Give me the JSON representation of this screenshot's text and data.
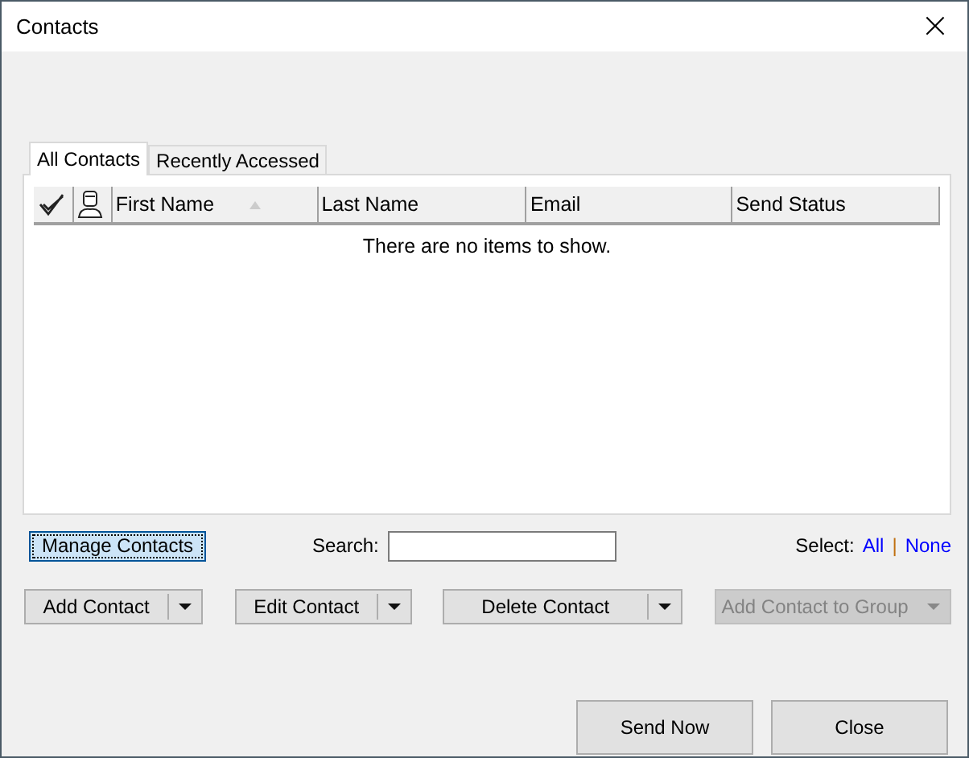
{
  "window": {
    "title": "Contacts",
    "close": "×"
  },
  "tabs": [
    {
      "label": "All Contacts",
      "selected": true
    },
    {
      "label": "Recently Accessed",
      "selected": false
    }
  ],
  "table": {
    "columns": [
      {
        "kind": "check"
      },
      {
        "kind": "person"
      },
      {
        "kind": "text",
        "label": "First Name",
        "sorted": true
      },
      {
        "kind": "text",
        "label": "Last Name",
        "sorted": false
      },
      {
        "kind": "text",
        "label": "Email",
        "sorted": false
      },
      {
        "kind": "text",
        "label": "Send Status",
        "sorted": false
      }
    ],
    "empty_message": "There are no items to show."
  },
  "manage_button": {
    "label": "Manage Contacts",
    "focused": true
  },
  "search": {
    "label": "Search:"
  },
  "select": {
    "label": "Select:",
    "all": "All",
    "separator": "|",
    "none": "None"
  },
  "actions": [
    {
      "label": "Add Contact",
      "disabled": false
    },
    {
      "label": "Edit Contact",
      "disabled": false
    },
    {
      "label": "Delete Contact",
      "disabled": false
    },
    {
      "label": "Add Contact to Group",
      "disabled": true
    }
  ],
  "footer_buttons": [
    "Send Now",
    "Close"
  ]
}
